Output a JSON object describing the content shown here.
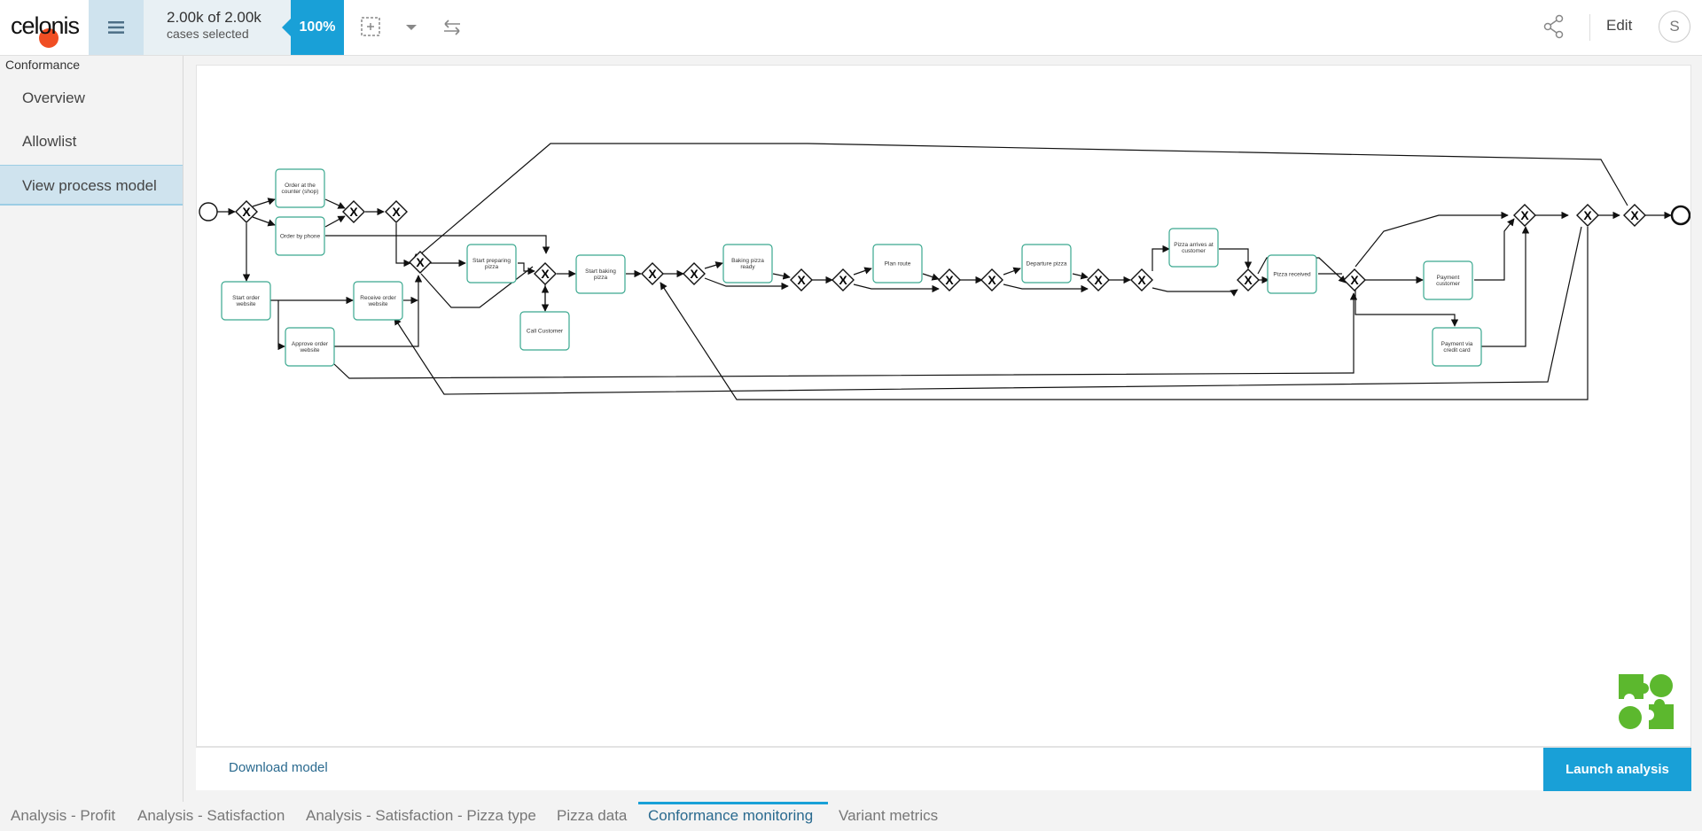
{
  "app": {
    "logo_text": "celonis",
    "brand_color": "#f04e23",
    "accent_color": "#19a0d7"
  },
  "topbar": {
    "cases_big": "2.00k of 2.00k",
    "cases_small": "cases selected",
    "percent": "100%",
    "edit_label": "Edit",
    "avatar_initial": "S"
  },
  "sidebar": {
    "section_title": "Conformance",
    "items": [
      {
        "label": "Overview",
        "active": false
      },
      {
        "label": "Allowlist",
        "active": false
      },
      {
        "label": "View process model",
        "active": true
      }
    ]
  },
  "model": {
    "activities": {
      "order_counter": [
        "Order at the",
        "counter (shop)"
      ],
      "order_phone": [
        "Order by phone"
      ],
      "start_order_website": [
        "Start order",
        "website"
      ],
      "receive_order_website": [
        "Receive order",
        "website"
      ],
      "approve_order_website": [
        "Approve order",
        "website"
      ],
      "start_preparing": [
        "Start preparing",
        "pizza"
      ],
      "call_customer": [
        "Call Customer"
      ],
      "start_baking": [
        "Start baking",
        "pizza"
      ],
      "baking_ready": [
        "Baking pizza",
        "ready"
      ],
      "plan_route": [
        "Plan route"
      ],
      "departure": [
        "Departure pizza"
      ],
      "pizza_arrives": [
        "Pizza arrives at",
        "customer"
      ],
      "pizza_received": [
        "Pizza received"
      ],
      "payment_customer": [
        "Payment",
        "customer"
      ],
      "payment_credit": [
        "Payment via",
        "credit card"
      ]
    },
    "gateway_symbol": "X"
  },
  "footer": {
    "download_label": "Download model",
    "launch_label": "Launch analysis"
  },
  "tabs": [
    {
      "label": "Analysis - Profit",
      "active": false
    },
    {
      "label": "Analysis - Satisfaction",
      "active": false
    },
    {
      "label": "Analysis - Satisfaction - Pizza type",
      "active": false
    },
    {
      "label": "Pizza data",
      "active": false
    },
    {
      "label": "Conformance monitoring",
      "active": true
    },
    {
      "label": "Variant metrics",
      "active": false
    }
  ],
  "icons": {
    "menu": "hamburger-icon",
    "selection": "selection-add-icon",
    "dropdown": "chevron-down-icon",
    "swap": "swap-arrows-icon",
    "share": "share-icon",
    "puzzle": "puzzle-icon"
  }
}
